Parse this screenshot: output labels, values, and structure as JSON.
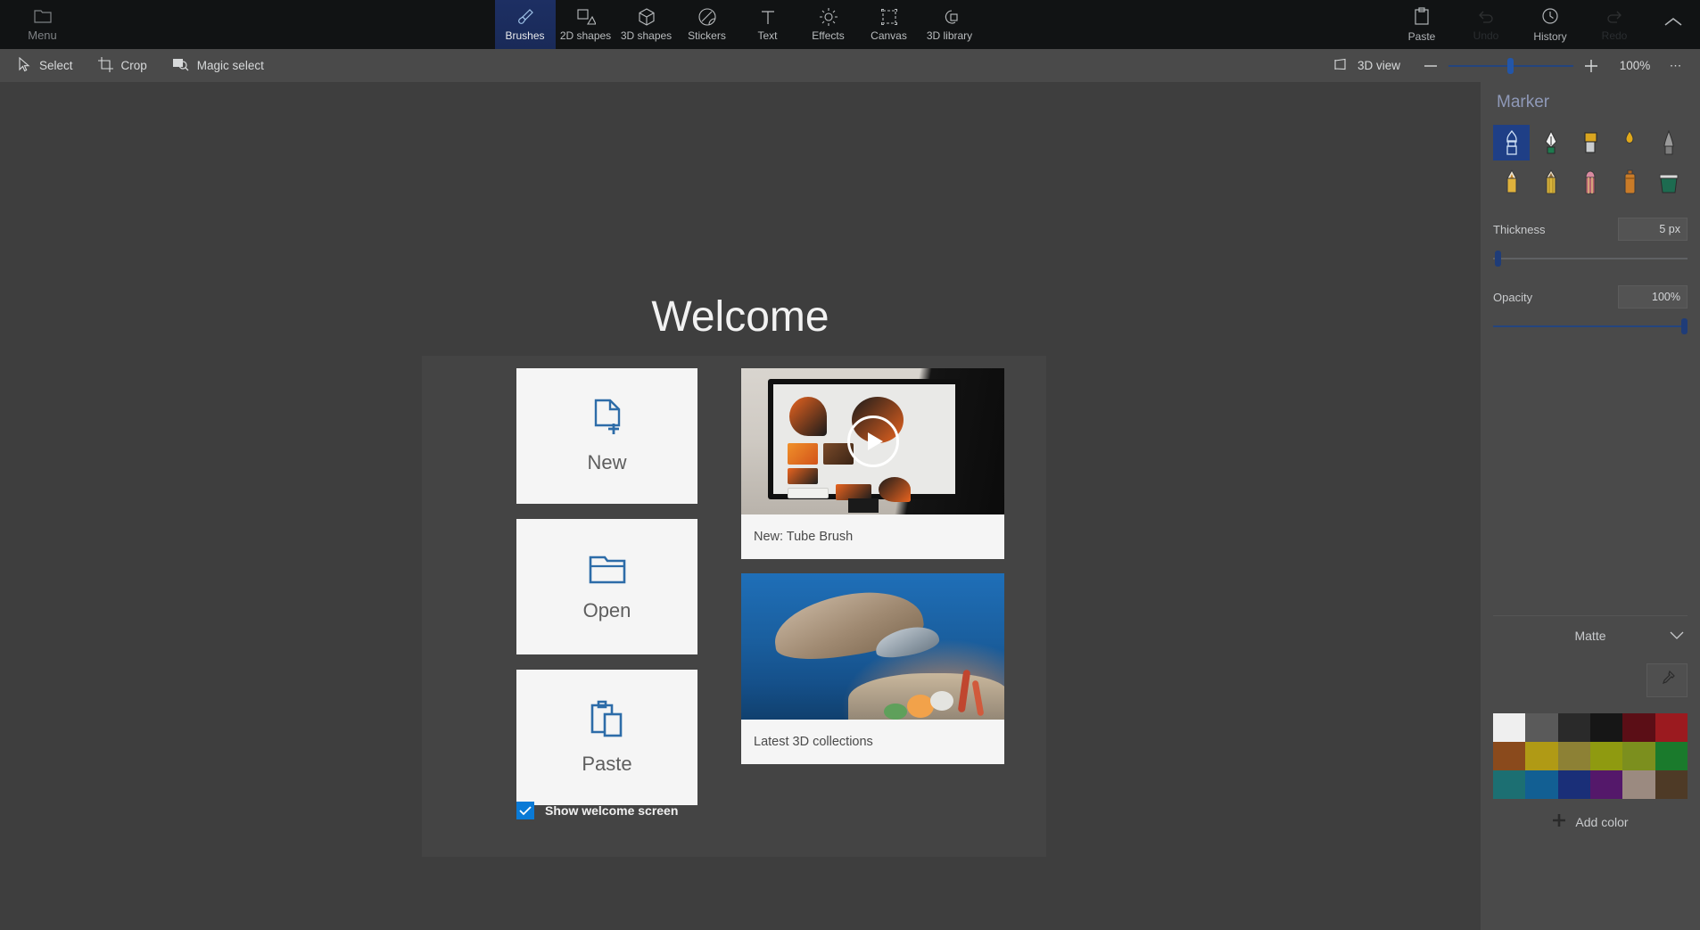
{
  "app": {
    "name": "Paint 3D",
    "accent": "#1f3f86",
    "ribbon_bg": "#111314",
    "toolbar_bg": "#4a4a4a",
    "canvas_bg": "#3e3e3e"
  },
  "ribbon": {
    "menu": {
      "label": "Menu",
      "icon": "folder-icon"
    },
    "tabs": [
      {
        "label": "Brushes",
        "icon": "brush-icon",
        "active": true
      },
      {
        "label": "2D shapes",
        "icon": "2d-shapes-icon",
        "active": false
      },
      {
        "label": "3D shapes",
        "icon": "3d-shapes-icon",
        "active": false
      },
      {
        "label": "Stickers",
        "icon": "stickers-icon",
        "active": false
      },
      {
        "label": "Text",
        "icon": "text-icon",
        "active": false
      },
      {
        "label": "Effects",
        "icon": "effects-icon",
        "active": false
      },
      {
        "label": "Canvas",
        "icon": "canvas-icon",
        "active": false
      },
      {
        "label": "3D library",
        "icon": "3d-library-icon",
        "active": false
      }
    ],
    "right_buttons": [
      {
        "label": "Paste",
        "icon": "paste-icon",
        "faint": false
      },
      {
        "label": "Undo",
        "icon": "undo-icon",
        "faint": true
      },
      {
        "label": "History",
        "icon": "history-icon",
        "faint": false
      },
      {
        "label": "Redo",
        "icon": "redo-icon",
        "faint": true
      }
    ],
    "collapse_icon": "chevron-up-icon"
  },
  "toolbar": {
    "items": [
      {
        "label": "Select",
        "icon": "cursor-icon"
      },
      {
        "label": "Crop",
        "icon": "crop-icon"
      },
      {
        "label": "Magic select",
        "icon": "magic-select-icon"
      }
    ],
    "view_3d": {
      "label": "3D view",
      "icon": "3d-view-icon"
    },
    "zoom_out_icon": "minus-icon",
    "zoom_in_icon": "plus-icon",
    "zoom_value": "100%",
    "zoom_slider_percent": 47,
    "more_icon": "ellipsis-icon"
  },
  "right_panel": {
    "title": "Marker",
    "brushes": [
      {
        "name": "marker-brush",
        "selected": true
      },
      {
        "name": "calligraphy-pen",
        "selected": false
      },
      {
        "name": "calligraphy-brush",
        "selected": false
      },
      {
        "name": "oil-brush",
        "selected": false
      },
      {
        "name": "watercolor-brush",
        "selected": false
      },
      {
        "name": "pixel-pen",
        "selected": false
      },
      {
        "name": "pencil",
        "selected": false
      },
      {
        "name": "crayon",
        "selected": false
      },
      {
        "name": "spray-can",
        "selected": false
      },
      {
        "name": "fill-bucket",
        "selected": false
      }
    ],
    "thickness": {
      "label": "Thickness",
      "value": "5 px",
      "slider_percent": 2
    },
    "opacity": {
      "label": "Opacity",
      "value": "100%",
      "slider_percent": 100
    },
    "material": {
      "label": "Matte",
      "chevron_icon": "chevron-down-icon"
    },
    "eyedropper_icon": "eyedropper-icon",
    "add_color": {
      "label": "Add color",
      "icon": "plus-icon"
    },
    "swatches": [
      "#efefef",
      "#5a5a5a",
      "#2a2a2a",
      "#161616",
      "#5b0e16",
      "#9b1a1f",
      "#8a4a1c",
      "#b09a15",
      "#8d8135",
      "#8f9a10",
      "#7c8f1e",
      "#1a7a2c",
      "#1c6f72",
      "#125f93",
      "#1a2f78",
      "#54186a",
      "#9b8a80",
      "#4e3a26"
    ]
  },
  "welcome": {
    "title": "Welcome",
    "actions": [
      {
        "label": "New",
        "icon": "new-file-icon"
      },
      {
        "label": "Open",
        "icon": "open-folder-icon"
      },
      {
        "label": "Paste",
        "icon": "paste-clipboard-icon"
      }
    ],
    "checkbox": {
      "label": "Show welcome screen",
      "checked": true,
      "icon": "checkmark-icon"
    },
    "media": [
      {
        "caption": "New: Tube Brush",
        "kind": "video",
        "play_icon": "play-icon"
      },
      {
        "caption": "Latest 3D collections",
        "kind": "image"
      }
    ]
  }
}
